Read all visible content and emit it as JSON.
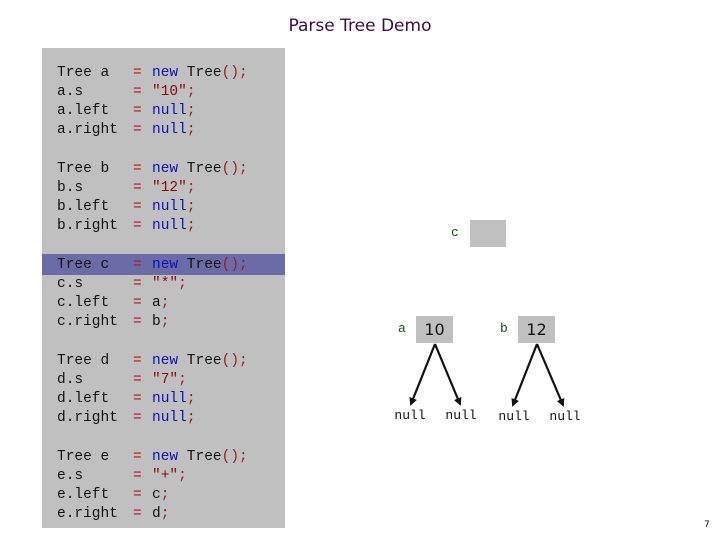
{
  "title": "Parse Tree Demo",
  "colors": {
    "panel": "#c0c0c0",
    "highlight": "#6b6ba8",
    "keyword": "#1010b8",
    "string": "#8a0a0a",
    "operator": "#c01010"
  },
  "code_blocks": [
    {
      "var": "a",
      "lines": [
        {
          "lhs": "Tree a",
          "eq": "=",
          "rhs": [
            {
              "t": "new",
              "c": "kw"
            },
            {
              "t": " Tree",
              "c": "ident"
            },
            {
              "t": "()",
              "c": "punc"
            },
            {
              "t": ";",
              "c": "punc"
            }
          ]
        },
        {
          "lhs": "a.s",
          "eq": "=",
          "rhs": [
            {
              "t": "\"10\"",
              "c": "str"
            },
            {
              "t": ";",
              "c": "punc"
            }
          ]
        },
        {
          "lhs": "a.left",
          "eq": "=",
          "rhs": [
            {
              "t": "null",
              "c": "kw"
            },
            {
              "t": ";",
              "c": "punc"
            }
          ]
        },
        {
          "lhs": "a.right",
          "eq": "=",
          "rhs": [
            {
              "t": "null",
              "c": "kw"
            },
            {
              "t": ";",
              "c": "punc"
            }
          ]
        }
      ]
    },
    {
      "var": "b",
      "lines": [
        {
          "lhs": "Tree b",
          "eq": "=",
          "rhs": [
            {
              "t": "new",
              "c": "kw"
            },
            {
              "t": " Tree",
              "c": "ident"
            },
            {
              "t": "()",
              "c": "punc"
            },
            {
              "t": ";",
              "c": "punc"
            }
          ]
        },
        {
          "lhs": "b.s",
          "eq": "=",
          "rhs": [
            {
              "t": "\"12\"",
              "c": "str"
            },
            {
              "t": ";",
              "c": "punc"
            }
          ]
        },
        {
          "lhs": "b.left",
          "eq": "=",
          "rhs": [
            {
              "t": "null",
              "c": "kw"
            },
            {
              "t": ";",
              "c": "punc"
            }
          ]
        },
        {
          "lhs": "b.right",
          "eq": "=",
          "rhs": [
            {
              "t": "null",
              "c": "kw"
            },
            {
              "t": ";",
              "c": "punc"
            }
          ]
        }
      ]
    },
    {
      "var": "c",
      "highlighted_line": 0,
      "lines": [
        {
          "lhs": "Tree c",
          "eq": "=",
          "rhs": [
            {
              "t": "new",
              "c": "kw"
            },
            {
              "t": " Tree",
              "c": "ident"
            },
            {
              "t": "()",
              "c": "punc"
            },
            {
              "t": ";",
              "c": "punc"
            }
          ]
        },
        {
          "lhs": "c.s",
          "eq": "=",
          "rhs": [
            {
              "t": "\"*\"",
              "c": "str"
            },
            {
              "t": ";",
              "c": "punc"
            }
          ]
        },
        {
          "lhs": "c.left",
          "eq": "=",
          "rhs": [
            {
              "t": "a",
              "c": "ident"
            },
            {
              "t": ";",
              "c": "punc"
            }
          ]
        },
        {
          "lhs": "c.right",
          "eq": "=",
          "rhs": [
            {
              "t": "b",
              "c": "ident"
            },
            {
              "t": ";",
              "c": "punc"
            }
          ]
        }
      ]
    },
    {
      "var": "d",
      "lines": [
        {
          "lhs": "Tree d",
          "eq": "=",
          "rhs": [
            {
              "t": "new",
              "c": "kw"
            },
            {
              "t": " Tree",
              "c": "ident"
            },
            {
              "t": "()",
              "c": "punc"
            },
            {
              "t": ";",
              "c": "punc"
            }
          ]
        },
        {
          "lhs": "d.s",
          "eq": "=",
          "rhs": [
            {
              "t": "\"7\"",
              "c": "str"
            },
            {
              "t": ";",
              "c": "punc"
            }
          ]
        },
        {
          "lhs": "d.left",
          "eq": "=",
          "rhs": [
            {
              "t": "null",
              "c": "kw"
            },
            {
              "t": ";",
              "c": "punc"
            }
          ]
        },
        {
          "lhs": "d.right",
          "eq": "=",
          "rhs": [
            {
              "t": "null",
              "c": "kw"
            },
            {
              "t": ";",
              "c": "punc"
            }
          ]
        }
      ]
    },
    {
      "var": "e",
      "lines": [
        {
          "lhs": "Tree e",
          "eq": "=",
          "rhs": [
            {
              "t": "new",
              "c": "kw"
            },
            {
              "t": " Tree",
              "c": "ident"
            },
            {
              "t": "()",
              "c": "punc"
            },
            {
              "t": ";",
              "c": "punc"
            }
          ]
        },
        {
          "lhs": "e.s",
          "eq": "=",
          "rhs": [
            {
              "t": "\"+\"",
              "c": "str"
            },
            {
              "t": ";",
              "c": "punc"
            }
          ]
        },
        {
          "lhs": "e.left",
          "eq": "=",
          "rhs": [
            {
              "t": "c",
              "c": "ident"
            },
            {
              "t": ";",
              "c": "punc"
            }
          ]
        },
        {
          "lhs": "e.right",
          "eq": "=",
          "rhs": [
            {
              "t": "d",
              "c": "ident"
            },
            {
              "t": ";",
              "c": "punc"
            }
          ]
        }
      ]
    }
  ],
  "tree": {
    "nodes": [
      {
        "id": "c",
        "label": "c",
        "value": ""
      },
      {
        "id": "a",
        "label": "a",
        "value": "10"
      },
      {
        "id": "b",
        "label": "b",
        "value": "12"
      }
    ],
    "null_labels": [
      "null",
      "null",
      "null",
      "null"
    ]
  },
  "page_number": "7"
}
